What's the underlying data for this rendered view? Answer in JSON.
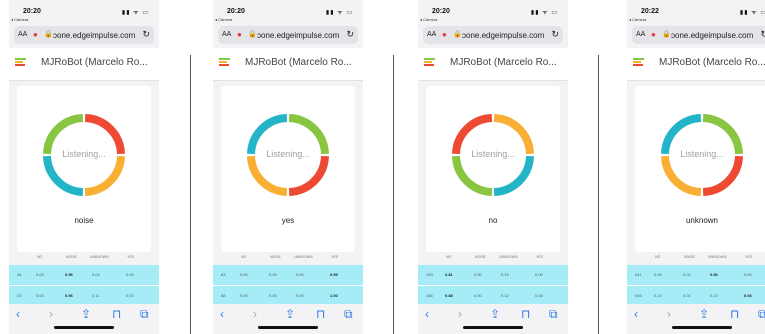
{
  "phones": [
    {
      "time": "20:20",
      "sub_status": "◂ Câmera",
      "status_icons": "▮▮ ᯤ ▭",
      "aa_label": "AA",
      "url": "ɔone.edgeimpulse.com",
      "project": "MJRoBot (Marcelo Ro...",
      "listening": "Listening...",
      "result": "noise",
      "headers": [
        "NO",
        "NOISE",
        "UNKNOWN",
        "YES"
      ],
      "rows": [
        {
          "id": "54",
          "values": [
            "0.00",
            "0.96",
            "0.02",
            "0.00"
          ]
        },
        {
          "id": "53",
          "values": [
            "0.00",
            "0.96",
            "0.11",
            "0.03"
          ]
        }
      ],
      "ring_colors": [
        "#ee4a33",
        "#f9ae34",
        "#23b4c7",
        "#88c540"
      ]
    },
    {
      "time": "20:20",
      "sub_status": "◂ Câmera",
      "status_icons": "▮▮ ᯤ ▭",
      "aa_label": "AA",
      "url": "ɔone.edgeimpulse.com",
      "project": "MJRoBot (Marcelo Ro...",
      "listening": "Listening...",
      "result": "yes",
      "headers": [
        "NO",
        "NOISE",
        "UNKNOWN",
        "YES"
      ],
      "rows": [
        {
          "id": "83",
          "values": [
            "0.00",
            "0.00",
            "0.00",
            "0.99"
          ]
        },
        {
          "id": "88",
          "values": [
            "0.00",
            "0.00",
            "0.00",
            "1.00"
          ]
        }
      ],
      "ring_colors": [
        "#88c540",
        "#ee4a33",
        "#f9ae34",
        "#23b4c7"
      ]
    },
    {
      "time": "20:20",
      "sub_status": "◂ Câmera",
      "status_icons": "▮▮ ᯤ ▭",
      "aa_label": "AA",
      "url": "ɔone.edgeimpulse.com",
      "project": "MJRoBot (Marcelo Ro...",
      "listening": "Listening...",
      "result": "no",
      "headers": [
        "NO",
        "NOISE",
        "UNKNOWN",
        "YES"
      ],
      "rows": [
        {
          "id": "153",
          "values": [
            "0.81",
            "0.00",
            "0.19",
            "0.00"
          ]
        },
        {
          "id": "156",
          "values": [
            "0.88",
            "0.00",
            "0.12",
            "0.00"
          ]
        }
      ],
      "ring_colors": [
        "#f9ae34",
        "#23b4c7",
        "#88c540",
        "#ee4a33"
      ]
    },
    {
      "time": "20:22",
      "sub_status": "◂ Câmera",
      "status_icons": "▮▮ ᯤ ▭",
      "aa_label": "AA",
      "url": "ɔone.edgeimpulse.com",
      "project": "MJRoBot (Marcelo Ro...",
      "listening": "Listening...",
      "result": "unknown",
      "headers": [
        "NO",
        "NOISE",
        "UNKNOWN",
        "YES"
      ],
      "rows": [
        {
          "id": "041",
          "values": [
            "0.09",
            "0.01",
            "0.90",
            "0.00"
          ]
        },
        {
          "id": "046",
          "values": [
            "0.24",
            "0.01",
            "0.22",
            "0.53"
          ]
        }
      ],
      "ring_colors": [
        "#88c540",
        "#ee4a33",
        "#f9ae34",
        "#23b4c7"
      ]
    }
  ],
  "icons": {
    "back": "back-arrow-icon",
    "forward": "forward-arrow-icon",
    "share": "share-icon",
    "bookmarks": "bookmarks-icon",
    "tabs": "tabs-icon",
    "mic": "microphone-icon",
    "lock": "lock-icon",
    "reload": "reload-icon",
    "logo": "edge-impulse-logo-icon"
  },
  "colors": {
    "row_highlight": "#a6ecf7",
    "accent": "#2a7ae2",
    "logo_bars": [
      "#88c540",
      "#f9ae34",
      "#ee4a33",
      "#23b4c7"
    ]
  }
}
